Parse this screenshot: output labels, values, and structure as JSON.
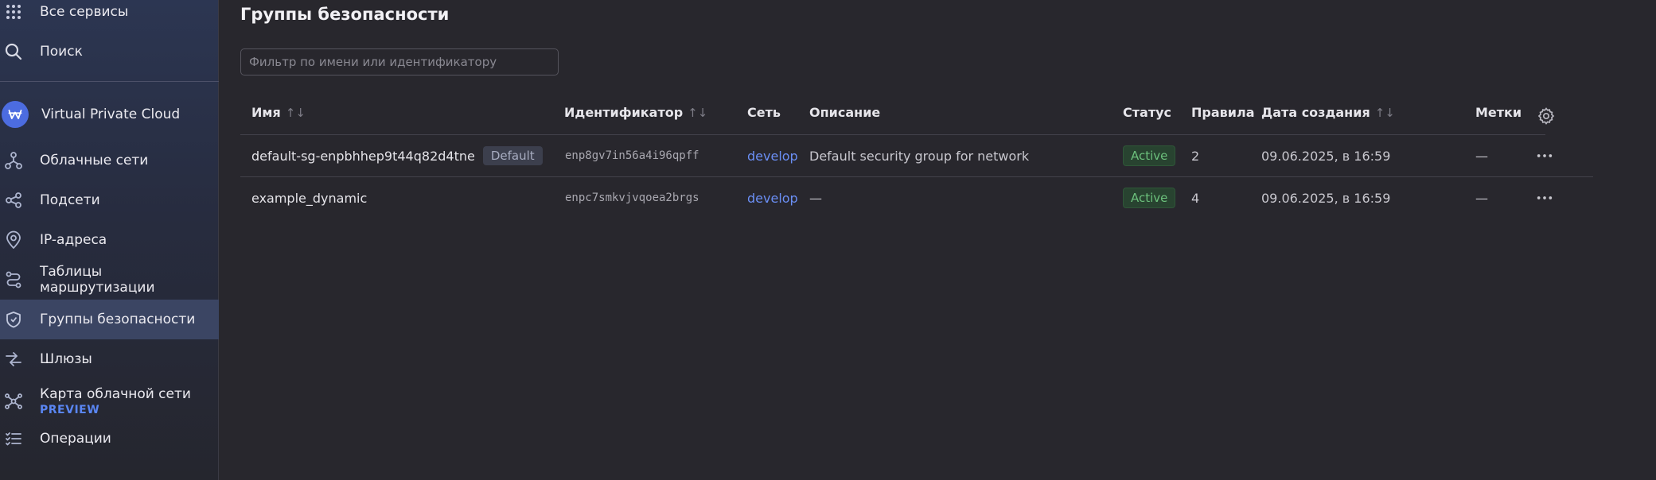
{
  "sidebar": {
    "items": [
      {
        "id": "all-services",
        "label": "Все сервисы"
      },
      {
        "id": "search",
        "label": "Поиск"
      },
      {
        "id": "vpc",
        "label": "Virtual Private Cloud"
      },
      {
        "id": "cloud-networks",
        "label": "Облачные сети"
      },
      {
        "id": "subnets",
        "label": "Подсети"
      },
      {
        "id": "ip-addresses",
        "label": "IP-адреса"
      },
      {
        "id": "route-tables",
        "label": "Таблицы маршрутизации"
      },
      {
        "id": "security-groups",
        "label": "Группы безопасности"
      },
      {
        "id": "gateways",
        "label": "Шлюзы"
      },
      {
        "id": "network-map",
        "label": "Карта облачной сети",
        "tag": "PREVIEW"
      },
      {
        "id": "operations",
        "label": "Операции"
      }
    ],
    "active": "security-groups",
    "accent": "#4c6ce0"
  },
  "page": {
    "title": "Группы безопасности",
    "filter_placeholder": "Фильтр по имени или идентификатору"
  },
  "table": {
    "columns": {
      "name": "Имя",
      "id": "Идентификатор",
      "network": "Сеть",
      "description": "Описание",
      "status": "Статус",
      "rules": "Правила",
      "created": "Дата создания",
      "labels": "Метки"
    },
    "rows": [
      {
        "name": "default-sg-enpbhhep9t44q82d4tne",
        "badge": "Default",
        "id": "enp8gv7in56a4i96qpff",
        "network": "develop",
        "description": "Default security group for network",
        "status": "Active",
        "rules": "2",
        "created": "09.06.2025, в 16:59",
        "labels": "—"
      },
      {
        "name": "example_dynamic",
        "id": "enpc7smkvjvqoea2brgs",
        "network": "develop",
        "description": "—",
        "status": "Active",
        "rules": "4",
        "created": "09.06.2025, в 16:59",
        "labels": "—"
      }
    ]
  },
  "colors": {
    "status_active": "#6cc07c",
    "link": "#6b8ff5"
  }
}
